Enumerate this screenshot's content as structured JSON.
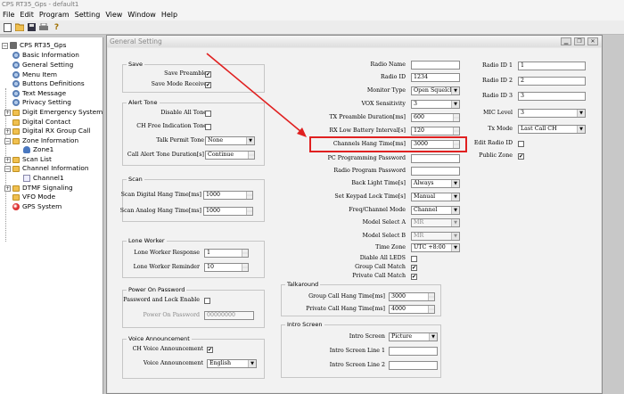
{
  "app": {
    "title": "CPS RT35_Gps - default1"
  },
  "menu": [
    "File",
    "Edit",
    "Program",
    "Setting",
    "View",
    "Window",
    "Help"
  ],
  "toolbar": {
    "icons": [
      "new-file-icon",
      "open-folder-icon",
      "save-icon",
      "print-icon",
      "help-icon"
    ]
  },
  "tree": {
    "root": "CPS RT35_Gps",
    "items": [
      {
        "label": "Basic Information",
        "icon": "gear"
      },
      {
        "label": "General Setting",
        "icon": "gear"
      },
      {
        "label": "Menu Item",
        "icon": "gear"
      },
      {
        "label": "Buttons Definitions",
        "icon": "gear"
      },
      {
        "label": "Text Message",
        "icon": "gear"
      },
      {
        "label": "Privacy Setting",
        "icon": "gear"
      },
      {
        "label": "Digit Emergency System",
        "icon": "folder"
      },
      {
        "label": "Digital Contact",
        "icon": "folder"
      },
      {
        "label": "Digital RX Group Call",
        "icon": "folder"
      },
      {
        "label": "Zone Information",
        "icon": "folder"
      },
      {
        "label": "Zone1",
        "icon": "person"
      },
      {
        "label": "Scan List",
        "icon": "folder"
      },
      {
        "label": "Channel Information",
        "icon": "folder"
      },
      {
        "label": "Channel1",
        "icon": "doc"
      },
      {
        "label": "DTMF Signaling",
        "icon": "folder"
      },
      {
        "label": "VFO Mode",
        "icon": "folder"
      },
      {
        "label": "GPS System",
        "icon": "globe"
      }
    ]
  },
  "window": {
    "title": "General Setting"
  },
  "save": {
    "legend": "Save",
    "preamble_label": "Save Preamble",
    "preamble_checked": "✔",
    "mode_receive_label": "Save Mode Receive",
    "mode_receive_checked": "✔"
  },
  "alert": {
    "legend": "Alert Tone",
    "disable_all_label": "Disable All Tone",
    "ch_free_label": "CH Free Indication Tone",
    "talk_permit_label": "Talk Permit Tone",
    "talk_permit_value": "None",
    "call_alert_label": "Call Alert Tone Duration[s]",
    "call_alert_value": "Continue"
  },
  "scan": {
    "legend": "Scan",
    "digital_label": "Scan Digital Hang Time[ms]",
    "digital_value": "1000",
    "analog_label": "Scan Analog Hang Time[ms]",
    "analog_value": "1000"
  },
  "lone": {
    "legend": "Lone Worker",
    "response_label": "Lone Worker Response",
    "response_value": "1",
    "reminder_label": "Lone Worker Reminder",
    "reminder_value": "10"
  },
  "poweron": {
    "legend": "Power On Password",
    "lock_label": "Password and Lock Enable",
    "password_label": "Power On Password",
    "password_value": "00000000"
  },
  "voice": {
    "legend": "Voice Announcement",
    "ch_voice_label": "CH Voice Announcement",
    "ch_voice_checked": "✔",
    "voice_label": "Voice Announcement",
    "voice_value": "English"
  },
  "middle": {
    "radio_name_label": "Radio Name",
    "radio_name_value": "",
    "radio_id_label": "Radio ID",
    "radio_id_value": "1234",
    "monitor_label": "Monitor Type",
    "monitor_value": "Open Squelch",
    "vox_label": "VOX Sensitivity",
    "vox_value": "3",
    "tx_preamble_label": "TX Preamble Duration[ms]",
    "tx_preamble_value": "600",
    "rx_low_label": "RX Low Battery Interval[s]",
    "rx_low_value": "120",
    "ch_hang_label": "Channels Hang Time[ms]",
    "ch_hang_value": "3000",
    "pc_prog_label": "PC Programming Password",
    "pc_prog_value": "",
    "radio_prog_label": "Radio Program Password",
    "radio_prog_value": "",
    "backlight_label": "Back Light Time[s]",
    "backlight_value": "Always",
    "keypad_label": "Set Keypad Lock Time[s]",
    "keypad_value": "Manual",
    "freq_label": "Freq/Channel Mode",
    "freq_value": "Channel",
    "model_a_label": "Model Select A",
    "model_a_value": "MR",
    "model_b_label": "Model Select B",
    "model_b_value": "MR",
    "timezone_label": "Time Zone",
    "timezone_value": "UTC +8:00",
    "disable_leds_label": "Diable All LEDS",
    "group_match_label": "Group Call Match",
    "group_match_checked": "✔",
    "private_match_label": "Private Call Match",
    "private_match_checked": "✔"
  },
  "talkaround": {
    "legend": "Talkaround",
    "group_label": "Group Call Hang Time[ms]",
    "group_value": "3000",
    "private_label": "Private Call Hang Time[ms]",
    "private_value": "4000"
  },
  "intro": {
    "legend": "Intro Screen",
    "screen_label": "Intro Screen",
    "screen_value": "Picture",
    "line1_label": "Intro Screen Line 1",
    "line1_value": "",
    "line2_label": "Intro Screen Line 2",
    "line2_value": ""
  },
  "right": {
    "id1_label": "Radio ID 1",
    "id1_value": "1",
    "id2_label": "Radio ID 2",
    "id2_value": "2",
    "id3_label": "Radio ID 3",
    "id3_value": "3",
    "mic_label": "MIC Level",
    "mic_value": "3",
    "txmode_label": "Tx Mode",
    "txmode_value": "Last Call CH",
    "edit_id_label": "Edit Radio ID",
    "public_zone_label": "Public Zone",
    "public_zone_checked": "✔"
  },
  "colors": {
    "highlight": "#e02020"
  }
}
